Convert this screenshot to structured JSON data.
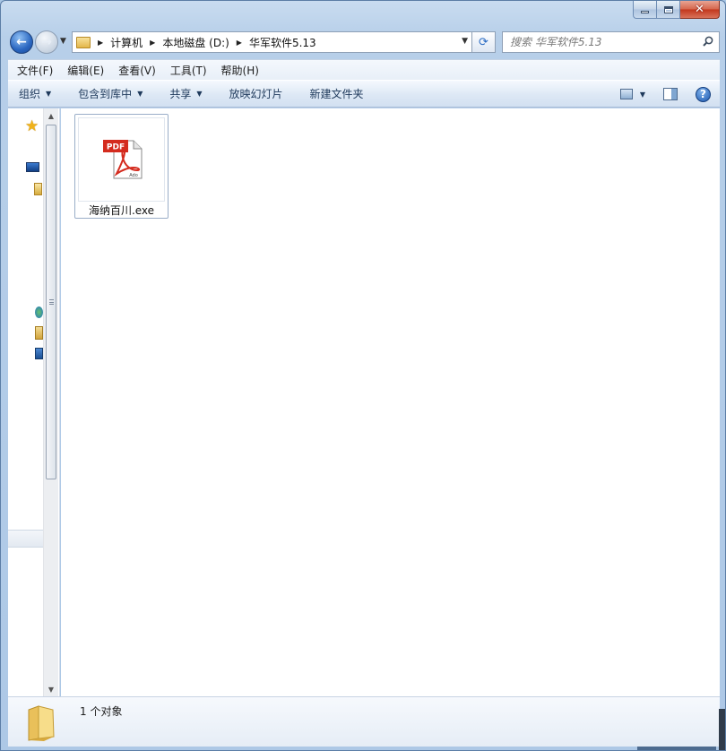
{
  "window": {
    "caption_buttons": {
      "close": "✕"
    }
  },
  "navigation": {
    "back_glyph": "←",
    "forward_glyph": "→",
    "breadcrumbs": [
      "计算机",
      "本地磁盘 (D:)",
      "华军软件5.13"
    ],
    "refresh_glyph": "⟳",
    "search_placeholder": "搜索 华军软件5.13"
  },
  "menubar": {
    "items": [
      "文件(F)",
      "编辑(E)",
      "查看(V)",
      "工具(T)",
      "帮助(H)"
    ]
  },
  "commandbar": {
    "organize": "组织",
    "include_in_library": "包含到库中",
    "share": "共享",
    "slideshow": "放映幻灯片",
    "new_folder": "新建文件夹",
    "help_glyph": "?"
  },
  "files": [
    {
      "name": "海纳百川.exe",
      "icon": "pdf-icon",
      "badge": "PDF"
    }
  ],
  "details": {
    "status": "1 个对象"
  },
  "colors": {
    "pdf_red": "#d42b1e",
    "frame": "#adc8e6"
  }
}
